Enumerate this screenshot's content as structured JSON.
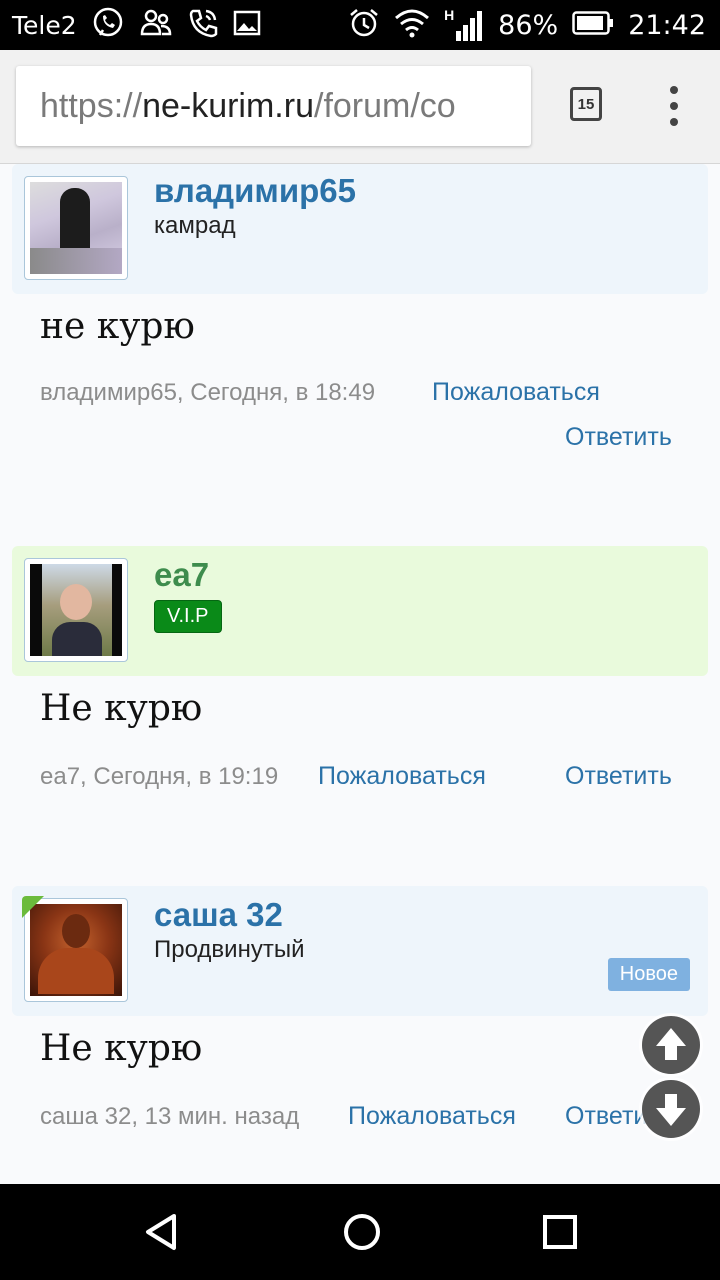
{
  "status_bar": {
    "carrier": "Tele2",
    "network_type": "H",
    "battery_percent": "86%",
    "time": "21:42",
    "icons": [
      "viber-icon",
      "people-icon",
      "phone-call-icon",
      "image-icon",
      "alarm-icon",
      "wifi-icon",
      "signal-icon",
      "battery-icon"
    ]
  },
  "browser": {
    "url_scheme": "https://",
    "url_domain": "ne-kurim.ru",
    "url_path": "/forum/co",
    "tab_count": "15"
  },
  "posts": [
    {
      "username": "владимир65",
      "user_title": "камрад",
      "message": "не курю",
      "meta": "владимир65, Сегодня, в 18:49",
      "report_label": "Пожаловаться",
      "reply_label": "Ответить"
    },
    {
      "username": "ea7",
      "badge": "V.I.P",
      "message": "Не курю",
      "meta": "ea7, Сегодня, в 19:19",
      "report_label": "Пожаловаться",
      "reply_label": "Ответить"
    },
    {
      "username": "саша 32",
      "user_title": "Продвинутый",
      "new_badge": "Новое",
      "message": "Не курю",
      "meta": "саша 32, 13 мин. назад",
      "report_label": "Пожаловаться",
      "reply_label": "Ответить"
    }
  ],
  "colors": {
    "link": "#2b72a8",
    "vip_badge": "#0a8a18",
    "new_badge": "#7fb1e0",
    "head_blue": "#eef5fb",
    "head_green": "#e9fadc"
  }
}
